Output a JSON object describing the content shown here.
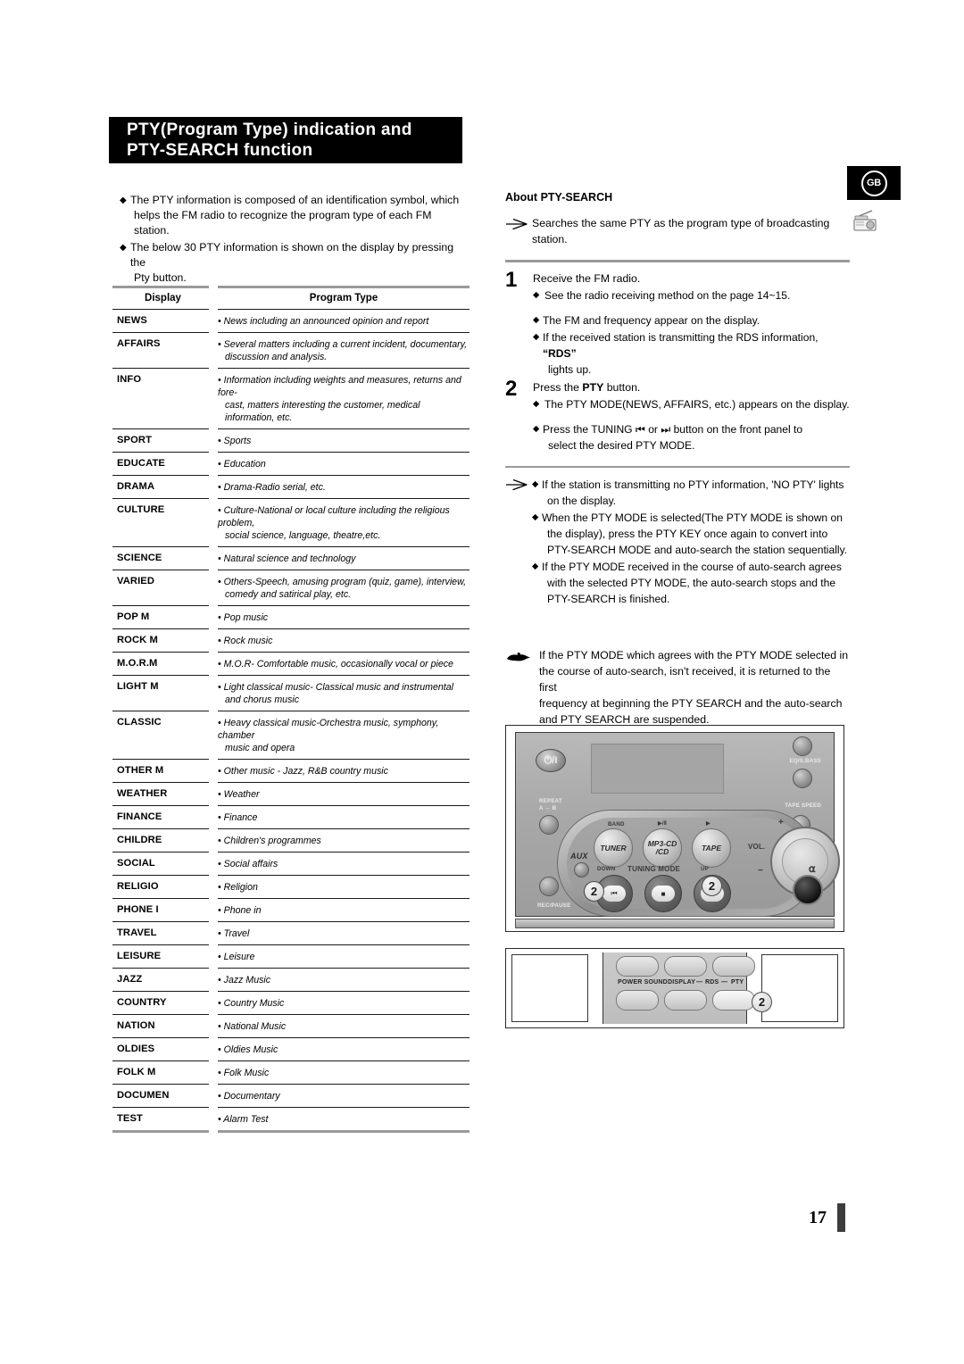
{
  "header": {
    "line1": "PTY(Program Type) indication and",
    "line2": "PTY-SEARCH function"
  },
  "badges": {
    "region": "GB",
    "radio_icon": "radio-icon"
  },
  "intro_bullets": [
    {
      "line1": "The PTY information is composed of an identification symbol, which",
      "line2": "helps the FM radio to recognize the program type of each FM station."
    },
    {
      "line1": "The below 30 PTY information is shown on the display by pressing the",
      "line2": "Pty button."
    }
  ],
  "table": {
    "headers": [
      "Display",
      "Program Type"
    ],
    "rows": [
      {
        "display": "NEWS",
        "desc": [
          "News including an announced opinion and report"
        ]
      },
      {
        "display": "AFFAIRS",
        "desc": [
          "Several matters including a current incident, documentary,",
          "discussion and analysis."
        ]
      },
      {
        "display": "INFO",
        "desc": [
          "Information including weights and measures, returns and fore-",
          "cast, matters interesting the customer, medical information, etc."
        ]
      },
      {
        "display": "SPORT",
        "desc": [
          "Sports"
        ]
      },
      {
        "display": "EDUCATE",
        "desc": [
          "Education"
        ]
      },
      {
        "display": "DRAMA",
        "desc": [
          "Drama-Radio serial, etc."
        ]
      },
      {
        "display": "CULTURE",
        "desc": [
          "Culture-National or local culture including the religious problem,",
          "social science, language, theatre,etc."
        ]
      },
      {
        "display": "SCIENCE",
        "desc": [
          "Natural science and technology"
        ]
      },
      {
        "display": "VARIED",
        "desc": [
          "Others-Speech, amusing program (quiz, game), interview,",
          "comedy and satirical play, etc."
        ]
      },
      {
        "display": "POP M",
        "desc": [
          "Pop music"
        ]
      },
      {
        "display": "ROCK M",
        "desc": [
          "Rock music"
        ]
      },
      {
        "display": "M.O.R.M",
        "desc": [
          "M.O.R- Comfortable music, occasionally vocal or piece"
        ]
      },
      {
        "display": "LIGHT M",
        "desc": [
          "Light classical music- Classical music and instrumental",
          "and chorus music"
        ]
      },
      {
        "display": "CLASSIC",
        "desc": [
          "Heavy classical  music-Orchestra music, symphony, chamber",
          "music and opera"
        ]
      },
      {
        "display": "OTHER M",
        "desc": [
          "Other music - Jazz, R&B country music"
        ]
      },
      {
        "display": "WEATHER",
        "desc": [
          "Weather"
        ]
      },
      {
        "display": "FINANCE",
        "desc": [
          "Finance"
        ]
      },
      {
        "display": "CHILDRE",
        "desc": [
          "Children's programmes"
        ]
      },
      {
        "display": "SOCIAL",
        "desc": [
          "Social affairs"
        ]
      },
      {
        "display": "RELIGIO",
        "desc": [
          "Religion"
        ]
      },
      {
        "display": "PHONE I",
        "desc": [
          "Phone in"
        ]
      },
      {
        "display": "TRAVEL",
        "desc": [
          "Travel"
        ]
      },
      {
        "display": "LEISURE",
        "desc": [
          "Leisure"
        ]
      },
      {
        "display": "JAZZ",
        "desc": [
          "Jazz Music"
        ]
      },
      {
        "display": "COUNTRY",
        "desc": [
          "Country Music"
        ]
      },
      {
        "display": "NATION",
        "desc": [
          "National Music"
        ]
      },
      {
        "display": "OLDIES",
        "desc": [
          "Oldies Music"
        ]
      },
      {
        "display": "FOLK M",
        "desc": [
          "Folk Music"
        ]
      },
      {
        "display": "DOCUMEN",
        "desc": [
          "Documentary"
        ]
      },
      {
        "display": "TEST",
        "desc": [
          "Alarm Test"
        ]
      }
    ]
  },
  "right": {
    "sub_head": "About PTY-SEARCH",
    "intro": {
      "line1": "Searches the same PTY as the program type of broadcasting",
      "line2": "station."
    },
    "step1": {
      "number": "1",
      "title": "Receive the FM radio.",
      "bullets": [
        {
          "text": "See the radio receiving method on the page 14~15."
        },
        {
          "text": "The FM and frequency appear on the display."
        },
        {
          "pre": "If the received station is transmitting the RDS information, ",
          "strong": "“RDS”",
          "cont": "lights up."
        }
      ]
    },
    "step2": {
      "number": "2",
      "title_pre": "Press the ",
      "title_strong": "PTY",
      "title_post": " button.",
      "bullets": [
        {
          "text": "The PTY MODE(NEWS, AFFAIRS, etc.) appears on the display."
        },
        {
          "pre": "Press the TUNING ",
          "icon1": "rewind-icon",
          "mid": " or ",
          "icon2": "fast-forward-icon",
          "post": " button on the front panel to",
          "cont": "select the desired PTY MODE."
        }
      ]
    },
    "notes": [
      {
        "line1": "If the station is transmitting no PTY information, 'NO PTY' lights",
        "line2": "on the display."
      },
      {
        "line1": "When the PTY MODE is selected(The PTY MODE is shown on",
        "line2": "the display), press the PTY KEY once again to convert into",
        "line3": "PTY-SEARCH MODE and auto-search the station sequentially."
      },
      {
        "line1": "If the PTY MODE received in the course of auto-search agrees",
        "line2": "with the selected PTY MODE, the auto-search stops and the",
        "line3": "PTY-SEARCH is finished."
      }
    ],
    "hand_note": {
      "line1": "If the PTY MODE which agrees with the PTY MODE selected in",
      "line2": "the course of auto-search, isn't received, it is returned to the first",
      "line3": "frequency at beginning the PTY SEARCH and the auto-search",
      "line4": "and PTY SEARCH are suspended."
    }
  },
  "figures": {
    "front_panel": {
      "power_glyph": "⏻/I",
      "labels": {
        "eq_s_bass": "EQ/S.BASS",
        "tape_speed": "TAPE SPEED",
        "repeat": "REPEAT",
        "repeat_ab": "A ↔ B",
        "rec_pause": "REC/PAUSE",
        "aux": "AUX",
        "band": "BAND",
        "play_pause": "▶/Ⅱ",
        "play": "▶",
        "tuning_mode": "TUNING MODE",
        "down": "DOWN",
        "up": "UP",
        "vol": "VOL.",
        "plus": "+",
        "minus": "−"
      },
      "buttons": {
        "tuner": "TUNER",
        "mp3cd_1": "MP3-CD",
        "mp3cd_2": "/CD",
        "tape": "TAPE"
      },
      "callouts": [
        "2",
        "2"
      ]
    },
    "remote": {
      "labels": {
        "power_sound": "POWER SOUND",
        "display": "DISPLAY",
        "rds": "RDS",
        "pty": "PTY",
        "dash1": "—",
        "dash2": "—"
      },
      "callout": "2"
    }
  },
  "page": {
    "number": "17"
  }
}
